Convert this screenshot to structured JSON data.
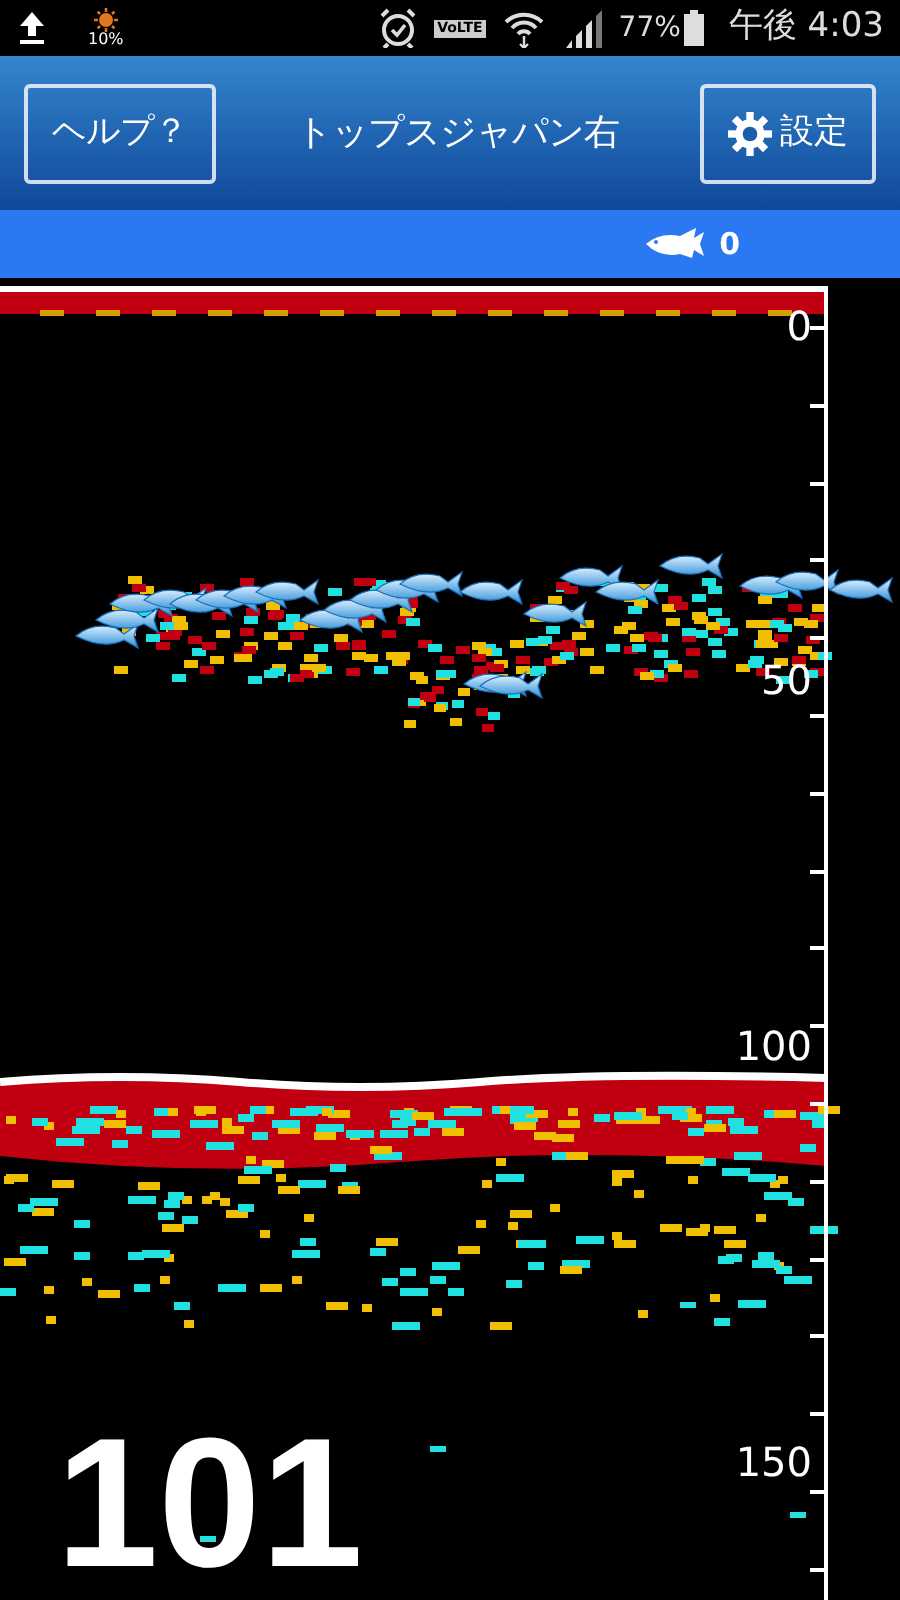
{
  "status_bar": {
    "battery_saver": "10%",
    "network": "VoLTE",
    "battery": "77%",
    "time": "午後 4:03"
  },
  "header": {
    "help_button": "ヘルプ？",
    "title": "トップスジャパン右",
    "settings_button": "設定"
  },
  "fish_count": "0",
  "depth_scale": {
    "labels": [
      "0",
      "50",
      "100",
      "150"
    ]
  },
  "depth_reading": "101"
}
